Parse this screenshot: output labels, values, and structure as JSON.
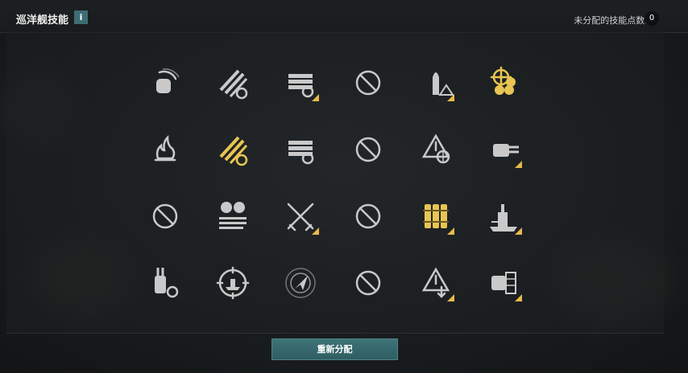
{
  "header": {
    "title": "巡洋舰技能",
    "info_label": "i",
    "points_label": "未分配的技能点数:",
    "points_value": "0"
  },
  "footer": {
    "reset_label": "重新分配"
  },
  "colors": {
    "accent": "#e8b94a",
    "button": "#3a6e73",
    "icon": "#c9c9c9",
    "active": "#e8c552"
  },
  "skills": [
    [
      {
        "icon": "turret-rotation-icon",
        "active": false,
        "corner": false
      },
      {
        "icon": "gun-reload-timer-icon",
        "active": false,
        "corner": false
      },
      {
        "icon": "torpedo-reload-icon",
        "active": false,
        "corner": true
      },
      {
        "icon": "unavailable-icon",
        "active": false,
        "corner": false
      },
      {
        "icon": "shell-warning-icon",
        "active": false,
        "corner": true
      },
      {
        "icon": "helm-propeller-icon",
        "active": true,
        "corner": false
      }
    ],
    [
      {
        "icon": "fire-icon",
        "active": false,
        "corner": false
      },
      {
        "icon": "gun-reload-icon",
        "active": true,
        "corner": false
      },
      {
        "icon": "torpedo-sight-icon",
        "active": false,
        "corner": false
      },
      {
        "icon": "unavailable-icon",
        "active": false,
        "corner": false
      },
      {
        "icon": "warning-target-icon",
        "active": false,
        "corner": false
      },
      {
        "icon": "secondary-gun-icon",
        "active": false,
        "corner": true
      }
    ],
    [
      {
        "icon": "unavailable-icon",
        "active": false,
        "corner": false
      },
      {
        "icon": "turret-ammo-icon",
        "active": false,
        "corner": false
      },
      {
        "icon": "crossed-swords-icon",
        "active": false,
        "corner": true
      },
      {
        "icon": "unavailable-icon",
        "active": false,
        "corner": false
      },
      {
        "icon": "torpedo-bundle-icon",
        "active": true,
        "corner": true
      },
      {
        "icon": "battleship-icon",
        "active": false,
        "corner": true
      }
    ],
    [
      {
        "icon": "turret-traverse-icon",
        "active": false,
        "corner": false
      },
      {
        "icon": "ship-target-icon",
        "active": false,
        "corner": false
      },
      {
        "icon": "radar-icon",
        "active": false,
        "corner": false
      },
      {
        "icon": "unavailable-icon",
        "active": false,
        "corner": false
      },
      {
        "icon": "warning-down-icon",
        "active": false,
        "corner": true
      },
      {
        "icon": "armor-plate-icon",
        "active": false,
        "corner": true
      }
    ]
  ]
}
